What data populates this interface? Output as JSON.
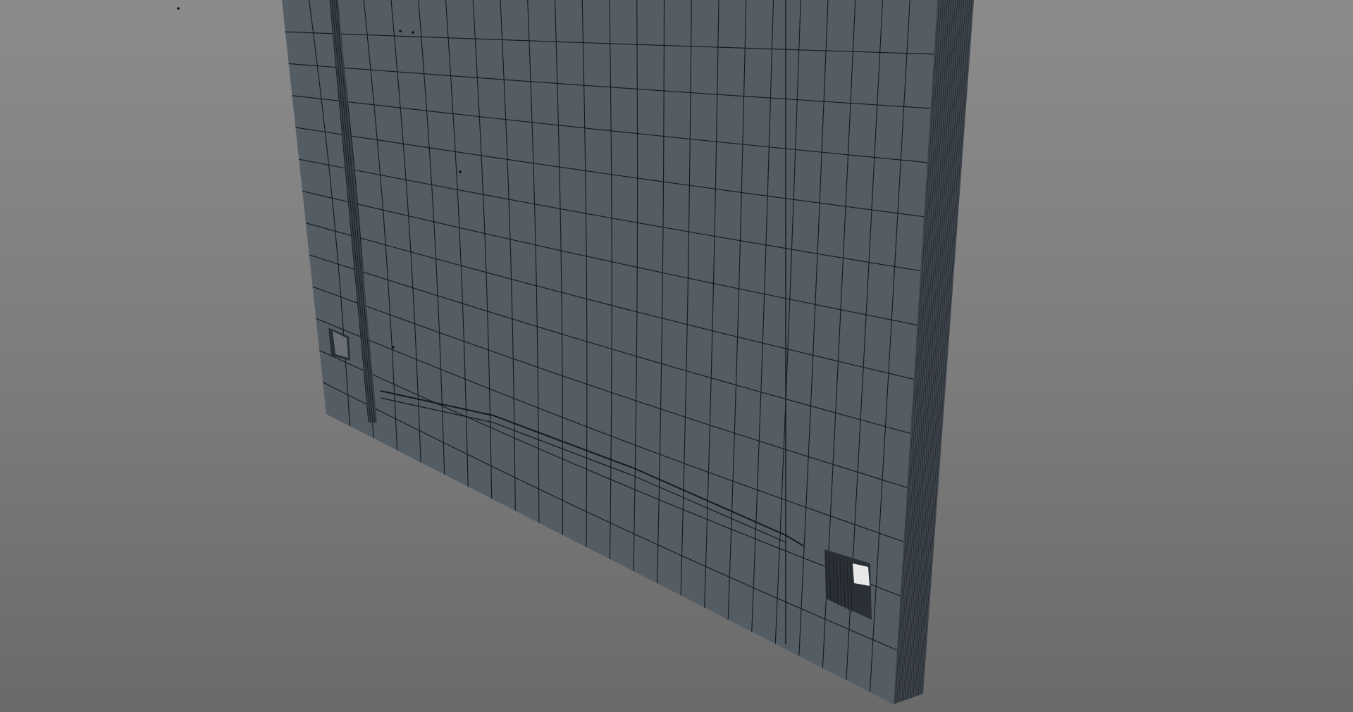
{
  "viewport": {
    "background_top": "#8b8b8b",
    "background_bottom": "#6a6a6a",
    "mesh_face_color": "#545c64",
    "mesh_side_color": "#3f454c",
    "wire_color": "#15191d"
  },
  "mesh": {
    "shading": "wireframe-on-shaded",
    "columns": 24,
    "rows": 13,
    "side_strip_lines": 18
  }
}
